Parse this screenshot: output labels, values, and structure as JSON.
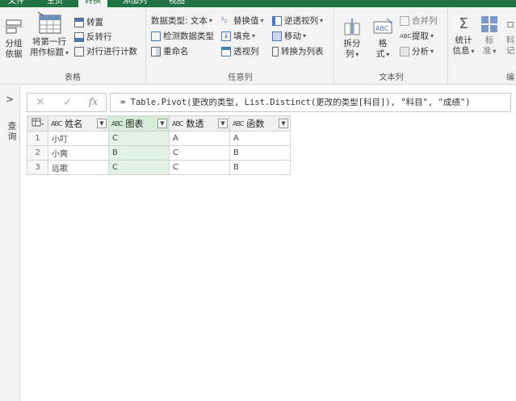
{
  "tabs": [
    {
      "label": "文件",
      "active": false
    },
    {
      "label": "主页",
      "active": false
    },
    {
      "label": "转换",
      "active": true
    },
    {
      "label": "添加列",
      "active": false
    },
    {
      "label": "视图",
      "active": false
    }
  ],
  "ribbon": {
    "table_group": {
      "label": "表格",
      "group_by": "分组\n依据",
      "use_first_row": "将第一行\n用作标题",
      "transpose": "转置",
      "reverse_rows": "反转行",
      "count_rows": "对行进行计数"
    },
    "any_column_group": {
      "label": "任意列",
      "data_type": "数据类型: 文本",
      "detect_type": "检测数据类型",
      "rename": "重命名",
      "replace_values": "替换值",
      "fill": "填充",
      "pivot_column": "透视列",
      "unpivot": "逆透视列",
      "move": "移动",
      "convert_to_list": "转换为列表"
    },
    "text_column_group": {
      "label": "文本列",
      "split": "拆分\n列",
      "format": "格\n式",
      "merge": "合并列",
      "extract": "提取",
      "parse": "分析"
    },
    "number_column_group": {
      "statistics": "统计\n信息",
      "standard": "标\n准",
      "scientific": "科\n记",
      "label_partial": "编"
    }
  },
  "left_pane": {
    "label": "查询",
    "collapse_glyph": ">"
  },
  "formula_bar": {
    "cancel": "✕",
    "commit": "✓",
    "fx": "fx",
    "formula": "= Table.Pivot(更改的类型, List.Distinct(更改的类型[科目]), \"科目\", \"成绩\")"
  },
  "table": {
    "columns": [
      {
        "type": "ABC",
        "name": "姓名"
      },
      {
        "type": "ABC",
        "name": "图表"
      },
      {
        "type": "ABC",
        "name": "数透"
      },
      {
        "type": "ABC",
        "name": "函数"
      }
    ],
    "rows": [
      {
        "num": "1",
        "cells": [
          "小叮",
          "C",
          "A",
          "A"
        ]
      },
      {
        "num": "2",
        "cells": [
          "小爽",
          "B",
          "C",
          "B"
        ]
      },
      {
        "num": "3",
        "cells": [
          "远歌",
          "C",
          "C",
          "B"
        ]
      }
    ]
  },
  "colors": {
    "accent": "#217346",
    "selected_column": "#e2f2e6"
  }
}
